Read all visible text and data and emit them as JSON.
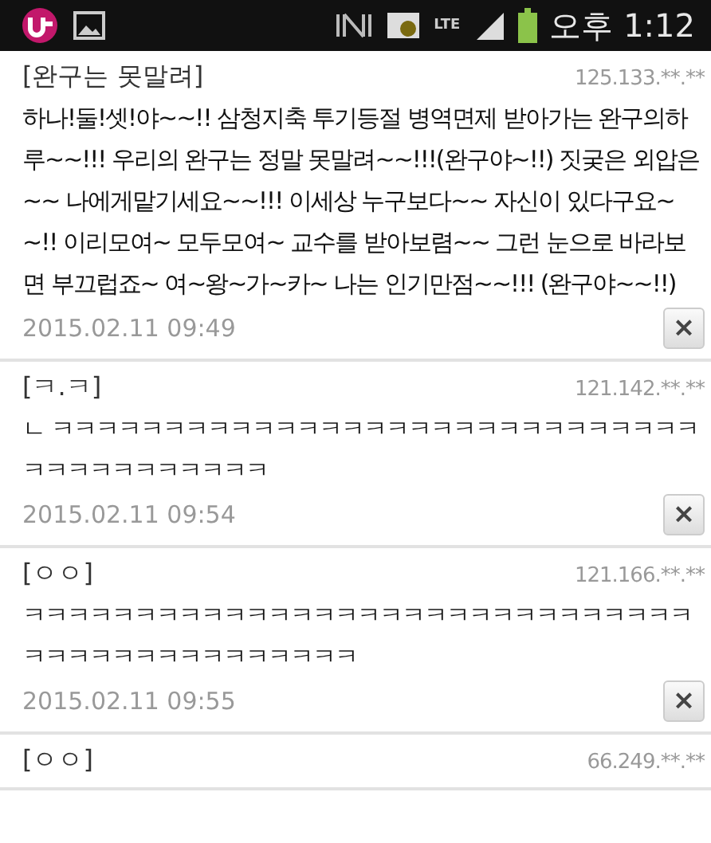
{
  "status_bar": {
    "time": "오후 1:12",
    "network": "LTE"
  },
  "comments": [
    {
      "author": "[완구는 못말려]",
      "ip": "125.133.**.**",
      "text": "하나!둘!셋!야~~!! 삼청지축 투기등절 병역면제 받아가는 완구의하루~~!!! 우리의 완구는 정말 못말려~~!!!(완구야~!!) 짓궂은 외압은~~ 나에게맡기세요~~!!! 이세상 누구보다~~ 자신이 있다구요~~!! 이리모여~ 모두모여~ 교수를 받아보렴~~ 그런 눈으로 바라보면 부끄럽죠~ 여~왕~가~카~ 나는 인기만점~~!!! (완구야~~!!)",
      "date": "2015.02.11 09:49",
      "delete": "×"
    },
    {
      "author": "[ㅋ.ㅋ]",
      "ip": "121.142.**.**",
      "text": "ㄴ ㅋㅋㅋㅋㅋㅋㅋㅋㅋㅋㅋㅋㅋㅋㅋㅋㅋㅋㅋㅋㅋㅋㅋㅋㅋㅋㅋㅋㅋㅋㅋㅋㅋㅋㅋㅋㅋㅋㅋㅋ",
      "date": "2015.02.11 09:54",
      "delete": "×"
    },
    {
      "author": "[ㅇㅇ]",
      "ip": "121.166.**.**",
      "text": "ㅋㅋㅋㅋㅋㅋㅋㅋㅋㅋㅋㅋㅋㅋㅋㅋㅋㅋㅋㅋㅋㅋㅋㅋㅋㅋㅋㅋㅋㅋㅋㅋㅋㅋㅋㅋㅋㅋㅋㅋㅋㅋㅋㅋㅋ",
      "date": "2015.02.11 09:55",
      "delete": "×"
    },
    {
      "author": "[ㅇㅇ]",
      "ip": "66.249.**.**"
    }
  ]
}
